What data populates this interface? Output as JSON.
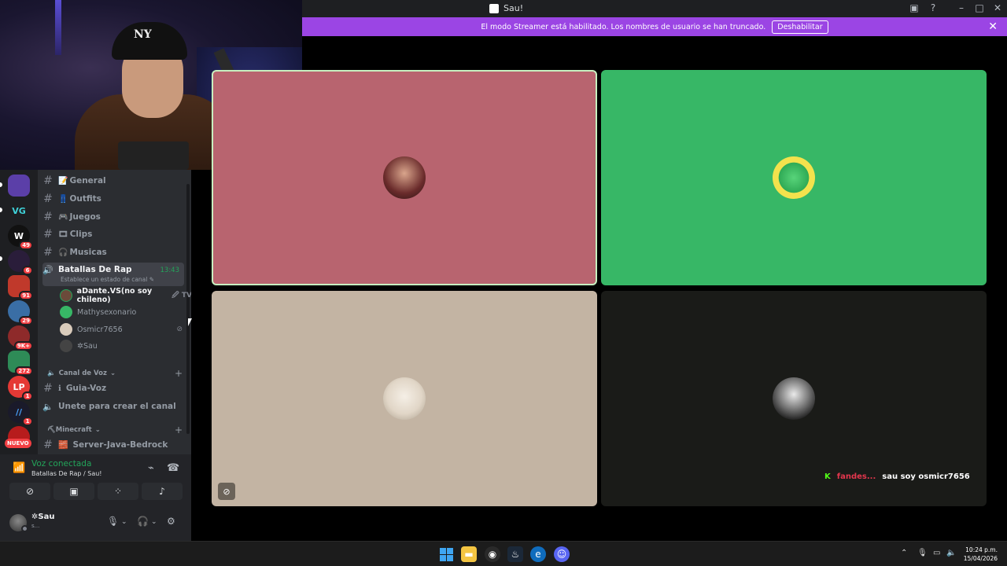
{
  "window": {
    "title": "Sau!"
  },
  "banner": {
    "message": "El modo Streamer está habilitado. Los nombres de usuario se han truncado.",
    "button_label": "Deshabilitar"
  },
  "servers": {
    "badges": [
      "49",
      "6",
      "91",
      "29",
      "9K+",
      "272",
      "1",
      "1"
    ],
    "vg_label": "VG",
    "lp_label": "LP",
    "new_label": "NUEVO"
  },
  "channels": {
    "items": [
      {
        "emoji": "📝",
        "name": "General"
      },
      {
        "emoji": "👖",
        "name": "Outfits"
      },
      {
        "emoji": "🎮",
        "name": "Juegos"
      },
      {
        "emoji": "🎞",
        "name": "Clips"
      },
      {
        "emoji": "🎧",
        "name": "Musicas"
      }
    ],
    "active_voice": {
      "name": "Batallas De Rap",
      "time": "13:43",
      "status": "Establece un estado de canal ✎"
    },
    "voice_users": [
      {
        "name": "aDante.VS(no soy chileno)",
        "extra": "🖉 TV"
      },
      {
        "name": "Mathysexonario",
        "extra": ""
      },
      {
        "name": "Osmicr7656",
        "extra": "🎧"
      },
      {
        "name": "✲Sau",
        "extra": ""
      }
    ],
    "category_voice": "Canal de Voz",
    "guia_voz": "Guia-Voz",
    "create_channel": "Unete para crear el canal",
    "category_minecraft": "⛏Minecraft",
    "server_java": "Server-Java-Bedrock"
  },
  "voice_panel": {
    "status": "Voz conectada",
    "location": "Batallas De Rap / Sau!",
    "username": "✲Sau",
    "user_sub": "s..."
  },
  "chat_overlay": {
    "platform_mark": "K",
    "user": "fandes...",
    "message": "sau soy osmicr7656"
  },
  "clock": {
    "time": "10:24 p.m.",
    "date": "15/04/2026"
  },
  "colors": {
    "brand_purple": "#9b45e4",
    "voice_green": "#23a55a",
    "tile_rose": "#b8646f",
    "tile_green": "#37b766",
    "tile_beige": "#c3b4a3",
    "tile_dark": "#1a1b18"
  }
}
